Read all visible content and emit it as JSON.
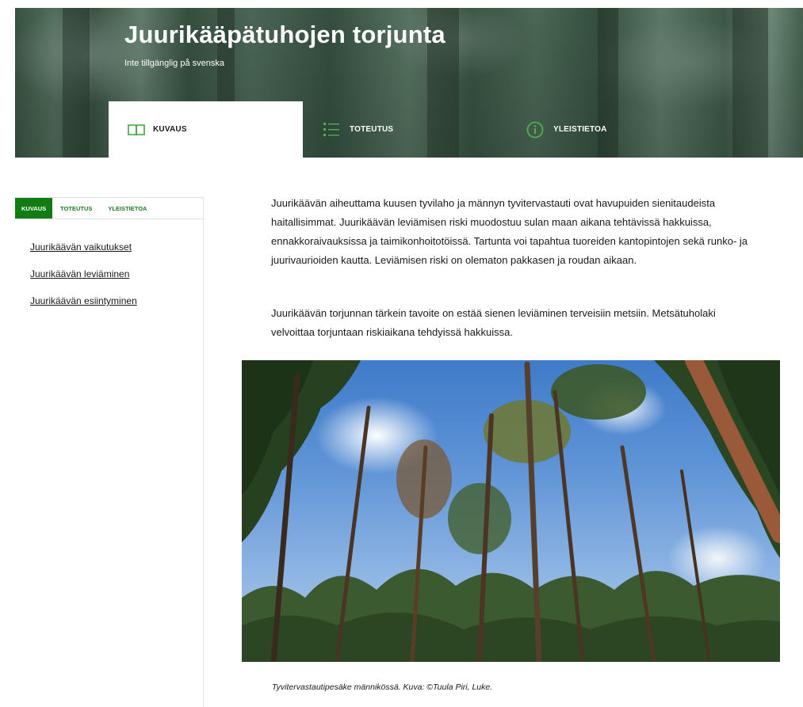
{
  "hero": {
    "title": "Juurikääpätuhojen torjunta",
    "subtitle": "Inte tillgänglig på svenska",
    "tabs": [
      {
        "label": "KUVAUS",
        "icon": "book-icon",
        "active": true
      },
      {
        "label": "TOTEUTUS",
        "icon": "list-icon",
        "active": false
      },
      {
        "label": "YLEISTIETOA",
        "icon": "info-icon",
        "active": false
      }
    ]
  },
  "sidebar": {
    "tabs": [
      {
        "label": "KUVAUS",
        "active": true
      },
      {
        "label": "TOTEUTUS",
        "active": false
      },
      {
        "label": "YLEISTIETOA",
        "active": false
      }
    ],
    "links": [
      "Juurikäävän vaikutukset",
      "Juurikäävän leviäminen",
      "Juurikäävän esiintyminen"
    ]
  },
  "main": {
    "paragraphs": [
      "Juurikäävän aiheuttama kuusen tyvilaho ja männyn tyvitervastauti ovat havupuiden sienitaudeista haitallisimmat. Juurikäävän leviämisen riski muodostuu sulan maan aikana tehtävissä hakkuissa, ennakkoraivauksissa ja taimikonhoitotöissä. Tartunta voi tapahtua tuoreiden kantopintojen sekä runko- ja juurivaurioiden kautta. Leviämisen riski on olematon pakkasen ja roudan aikaan.",
      "Juurikäävän torjunnan tärkein tavoite on estää sienen leviäminen terveisiin metsiin. Metsätuholaki velvoittaa torjuntaan riskiaikana tehdyissä hakkuissa."
    ],
    "image_caption": "Tyvitervastautipesäke männikössä. Kuva: ©Tuula Piri, Luke."
  },
  "colors": {
    "brand_green": "#0f7d12",
    "link_text": "#1a1a1a",
    "icon_green": "#3fa53f"
  }
}
